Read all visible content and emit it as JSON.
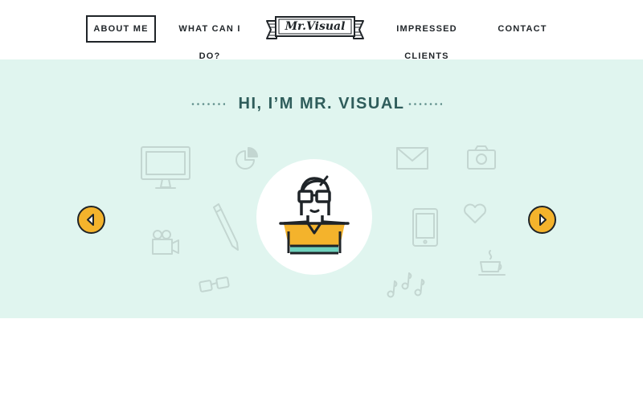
{
  "nav": {
    "about": "ABOUT ME",
    "what": "WHAT CAN I DO?",
    "clients": "IMPRESSED CLIENTS",
    "contact": "CONTACT"
  },
  "logo": {
    "text": "Mr.Visual"
  },
  "hero": {
    "title": "HI, I’M MR. VISUAL",
    "background": "#e0f5ef",
    "accent": "#f4b32c",
    "teal": "#6fd1bd",
    "dark": "#1f2428"
  },
  "icons": [
    "monitor-icon",
    "pie-chart-icon",
    "envelope-icon",
    "camera-icon",
    "pencil-icon",
    "phone-icon",
    "heart-icon",
    "video-camera-icon",
    "coffee-cup-icon",
    "glasses-icon",
    "music-notes-icon",
    "arrow-left-icon",
    "arrow-right-icon"
  ]
}
